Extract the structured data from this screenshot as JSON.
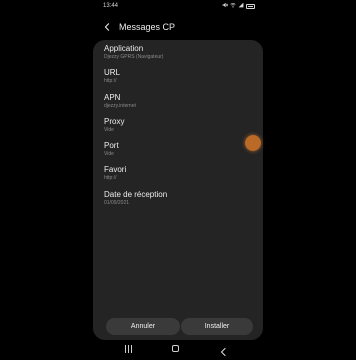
{
  "status_bar": {
    "time": "13:44",
    "icons": [
      "mute-icon",
      "wifi-icon",
      "signal-icon",
      "battery-icon"
    ]
  },
  "header": {
    "title": "Messages CP",
    "back_icon": "back-arrow-icon"
  },
  "fields": [
    {
      "label": "Application",
      "value": "Djezzy GPRS (Navigateur)"
    },
    {
      "label": "URL",
      "value": "http://"
    },
    {
      "label": "APN",
      "value": "djezzy.internet"
    },
    {
      "label": "Proxy",
      "value": "Vide"
    },
    {
      "label": "Port",
      "value": "Vide"
    },
    {
      "label": "Favori",
      "value": "http://"
    },
    {
      "label": "Date de réception",
      "value": "01/09/2021"
    }
  ],
  "buttons": {
    "cancel_label": "Annuler",
    "install_label": "Installer"
  },
  "nav_bar": {
    "icons": [
      "recents-icon",
      "home-icon",
      "back-icon"
    ]
  },
  "colors": {
    "background": "#000000",
    "card": "#242424",
    "button": "#3a3a3a",
    "touch_indicator": "#d67628"
  }
}
